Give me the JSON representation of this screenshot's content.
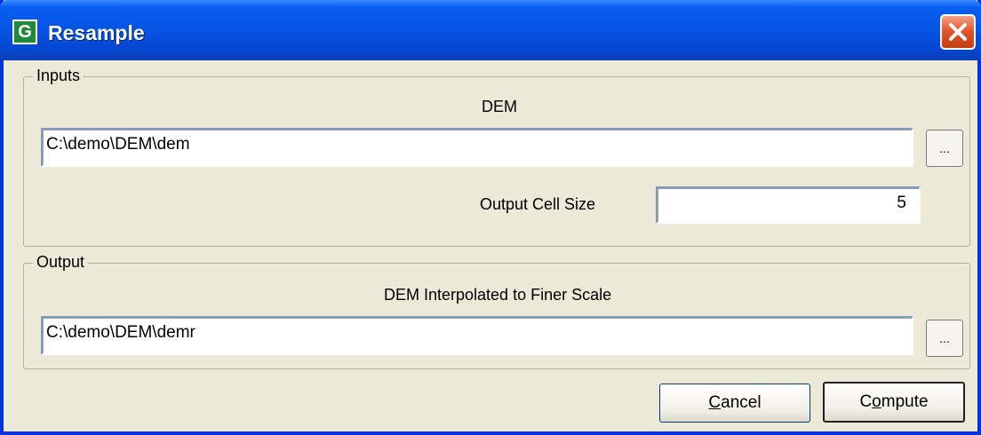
{
  "window": {
    "title": "Resample",
    "app_icon_letter": "G"
  },
  "inputs": {
    "legend": "Inputs",
    "dem_label": "DEM",
    "dem_path": "C:\\demo\\DEM\\dem",
    "browse_label": "...",
    "cell_size_label": "Output Cell Size",
    "cell_size_value": "5"
  },
  "output": {
    "legend": "Output",
    "result_label": "DEM Interpolated to Finer Scale",
    "result_path": "C:\\demo\\DEM\\demr",
    "browse_label": "..."
  },
  "buttons": {
    "cancel_prefix": "",
    "cancel_mnemonic": "C",
    "cancel_rest": "ancel",
    "compute_prefix": "C",
    "compute_mnemonic": "o",
    "compute_rest": "mpute"
  },
  "colors": {
    "title_bar": "#0655e6",
    "close_button": "#e2582f",
    "dialog_bg": "#ece9d8",
    "app_icon": "#1e8a3a"
  }
}
